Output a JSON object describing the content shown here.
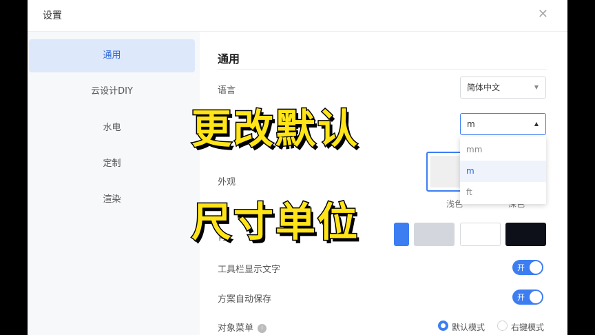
{
  "dialog": {
    "title": "设置",
    "close_icon": "close-icon"
  },
  "sidebar": {
    "items": [
      {
        "label": "通用",
        "active": true
      },
      {
        "label": "云设计DIY",
        "active": false
      },
      {
        "label": "水电",
        "active": false
      },
      {
        "label": "定制",
        "active": false
      },
      {
        "label": "渲染",
        "active": false
      }
    ]
  },
  "main": {
    "section_title": "通用",
    "language": {
      "label": "语言",
      "value": "简体中文"
    },
    "unit": {
      "value": "m",
      "options": [
        "mm",
        "m",
        "ft"
      ],
      "selected": "m"
    },
    "appearance": {
      "label": "外观",
      "themes": [
        {
          "label": "浅色"
        },
        {
          "label": "深色"
        }
      ]
    },
    "background": {
      "label": "背",
      "swatch_colors": [
        "#3c7ef2",
        "#d3d6dc",
        "#ffffff",
        "#0d1018"
      ]
    },
    "toolbar_text": {
      "label": "工具栏显示文字",
      "toggle": "开",
      "on": true
    },
    "autosave": {
      "label": "方案自动保存",
      "toggle": "开",
      "on": true
    },
    "object_menu": {
      "label": "对象菜单",
      "info_icon": "info-icon",
      "options": [
        {
          "label": "默认模式",
          "checked": true
        },
        {
          "label": "右键模式",
          "checked": false
        }
      ]
    }
  },
  "overlay": {
    "line1": "更改默认",
    "line2": "尺寸单位"
  },
  "colors": {
    "accent": "#3c7ef2",
    "overlay_text": "#ffe418"
  }
}
